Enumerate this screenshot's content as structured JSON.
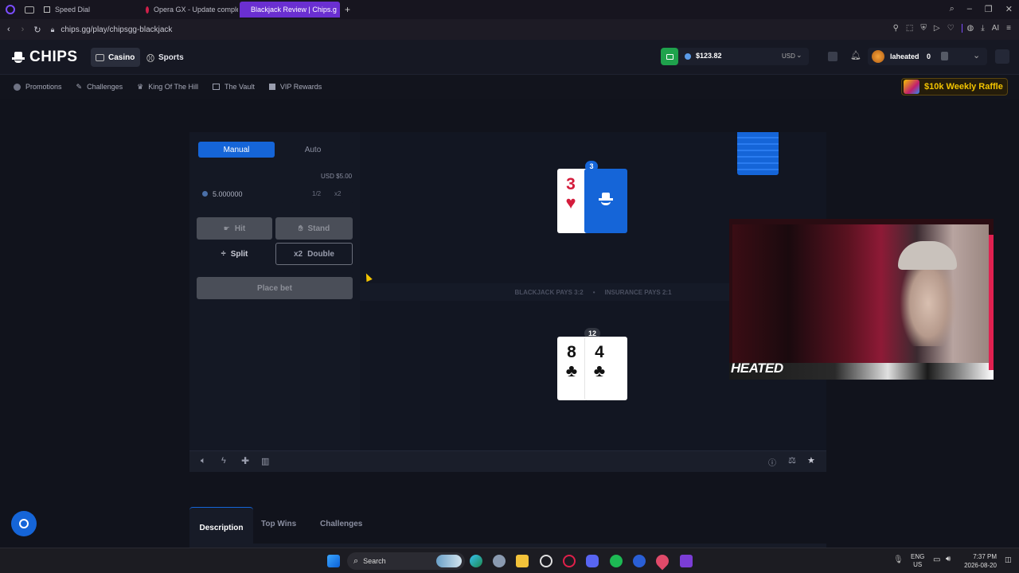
{
  "browser": {
    "tabs": [
      {
        "label": "Speed Dial",
        "active": false
      },
      {
        "label": "Opera GX - Update comple",
        "active": false
      },
      {
        "label": "Blackjack Review | Chips.g",
        "active": true
      }
    ],
    "url": "chips.gg/play/chipsgg-blackjack"
  },
  "header": {
    "logo": "CHIPS",
    "nav": [
      "Casino",
      "Sports"
    ],
    "balance": "$123.82",
    "currency": "USD",
    "username": "laheated",
    "level": "0"
  },
  "subnav": {
    "items": [
      "Promotions",
      "Challenges",
      "King Of The Hill",
      "The Vault",
      "VIP Rewards"
    ],
    "raffle": "$10k Weekly Raffle"
  },
  "controls": {
    "modes": [
      "Manual",
      "Auto"
    ],
    "bet_usd": "USD $5.00",
    "bet_value": "5.000000",
    "half": "1/2",
    "double_bet": "x2",
    "hit": "Hit",
    "stand": "Stand",
    "split": "Split",
    "double_prefix": "x2",
    "double": "Double",
    "place_bet": "Place bet"
  },
  "table": {
    "dealer_total": "3",
    "dealer_card_rank": "3",
    "dealer_card_suit": "♥",
    "player_total": "12",
    "player_cards": [
      {
        "rank": "8",
        "suit": "♣"
      },
      {
        "rank": "4",
        "suit": "♣"
      }
    ],
    "rule_blackjack": "BLACKJACK PAYS 3:2",
    "rule_sep": "•",
    "rule_insurance": "INSURANCE PAYS 2:1"
  },
  "webcam": {
    "overlay_text": "HEATED"
  },
  "tabs_bottom": [
    "Description",
    "Top Wins",
    "Challenges"
  ],
  "taskbar": {
    "search": "Search",
    "lang_top": "ENG",
    "lang_bottom": "US",
    "time": "7:37 PM",
    "date": "2026-08-20"
  },
  "colors": {
    "accent_blue": "#1565d8",
    "page_bg": "#11131c",
    "panel_bg": "#141824",
    "card_red": "#d41c3c",
    "raffle_gold": "#f3c400",
    "balance_green": "#1fa24c"
  }
}
